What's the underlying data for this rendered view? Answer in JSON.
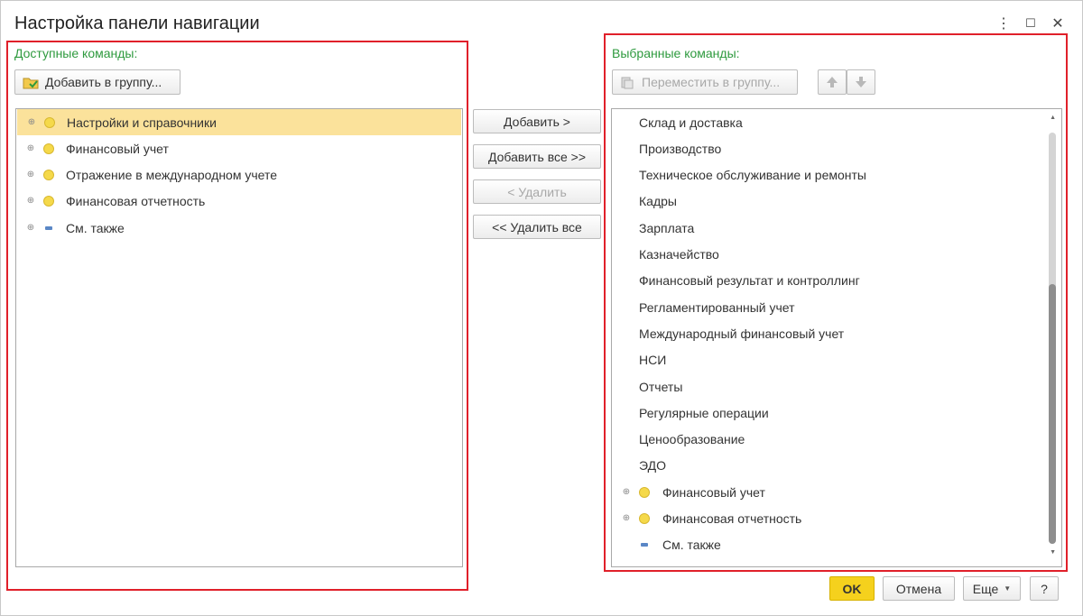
{
  "window": {
    "title": "Настройка панели навигации",
    "menu_icon": "⋮",
    "maximize_icon": "☐",
    "close_icon": "✕"
  },
  "left": {
    "label": "Доступные команды:",
    "add_to_group": "Добавить в группу...",
    "items": [
      {
        "label": "Настройки и справочники",
        "icon": "yellow-dot",
        "selected": true
      },
      {
        "label": "Финансовый учет",
        "icon": "yellow-dot"
      },
      {
        "label": "Отражение в международном учете",
        "icon": "yellow-dot"
      },
      {
        "label": "Финансовая отчетность",
        "icon": "yellow-dot"
      },
      {
        "label": "См. также",
        "icon": "blue-dash"
      }
    ]
  },
  "middle": {
    "add": "Добавить >",
    "add_all": "Добавить все >>",
    "remove": "< Удалить",
    "remove_all": "<< Удалить все"
  },
  "right": {
    "label": "Выбранные команды:",
    "move_to_group": "Переместить в группу...",
    "items": [
      {
        "label": "Склад и доставка"
      },
      {
        "label": "Производство"
      },
      {
        "label": "Техническое обслуживание и ремонты"
      },
      {
        "label": "Кадры"
      },
      {
        "label": "Зарплата"
      },
      {
        "label": "Казначейство"
      },
      {
        "label": "Финансовый результат и контроллинг"
      },
      {
        "label": "Регламентированный учет"
      },
      {
        "label": "Международный финансовый учет"
      },
      {
        "label": "НСИ"
      },
      {
        "label": "Отчеты"
      },
      {
        "label": "Регулярные операции"
      },
      {
        "label": "Ценообразование"
      },
      {
        "label": "ЭДО"
      },
      {
        "label": "Финансовый учет",
        "icon": "yellow-dot",
        "expandable": true
      },
      {
        "label": "Финансовая отчетность",
        "icon": "yellow-dot",
        "expandable": true
      },
      {
        "label": "См. также",
        "icon": "blue-dash"
      }
    ]
  },
  "footer": {
    "ok": "OK",
    "cancel": "Отмена",
    "more": "Еще",
    "help": "?"
  },
  "colors": {
    "accent_green": "#2e9a3e",
    "highlight_red": "#e0202a",
    "selection_yellow": "#fbe29b",
    "ok_yellow": "#f5d11d"
  }
}
